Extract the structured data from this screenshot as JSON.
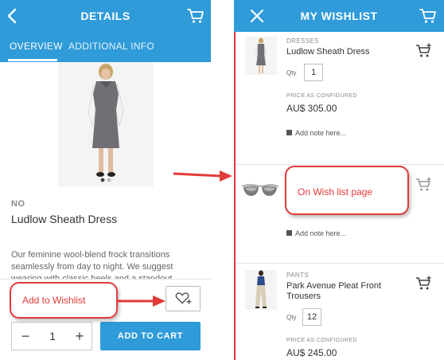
{
  "details_screen": {
    "title": "DETAILS",
    "tabs": [
      {
        "label": "OVERVIEW",
        "active": true
      },
      {
        "label": "ADDITIONAL INFO",
        "active": false
      }
    ],
    "image_dots": 2,
    "image_active_dot": 0,
    "brand": "NO",
    "product_name": "Ludlow Sheath Dress",
    "description": "Our feminine wool-blend frock transitions seamlessly from day to night. We suggest wearing with classic heels and a standout",
    "quantity": "1",
    "add_to_cart_label": "ADD TO CART",
    "icons": {
      "back": "chevron-left-icon",
      "cart": "cart-icon",
      "wishlist": "heart-plus-icon",
      "minus": "minus-icon",
      "plus": "plus-icon"
    }
  },
  "wishlist_screen": {
    "title": "MY WISHLIST",
    "icons": {
      "close": "close-icon",
      "cart": "cart-icon"
    },
    "items": [
      {
        "category": "DRESSES",
        "name": "Ludlow Sheath Dress",
        "qty_label": "Qty",
        "qty": "1",
        "price_label": "PRICE AS CONFIGURED",
        "price": "AU$ 305.00",
        "note_label": "Add note here..."
      },
      {
        "category": "",
        "name": "",
        "thumbnail": "sunglasses",
        "note_label": "Add note here..."
      },
      {
        "category": "PANTS",
        "name_line1": "Park Avenue Pleat Front",
        "name_line2": "Trousers",
        "qty_label": "Qty",
        "qty": "12",
        "price_label": "PRICE AS CONFIGURED",
        "price": "AU$ 245.00"
      }
    ]
  },
  "annotations": {
    "add_to_wishlist": "Add to Wishlist",
    "on_wishlist_page": "On Wish list page"
  },
  "colors": {
    "primary": "#2f9bd9",
    "annotation": "#e23a3a"
  }
}
